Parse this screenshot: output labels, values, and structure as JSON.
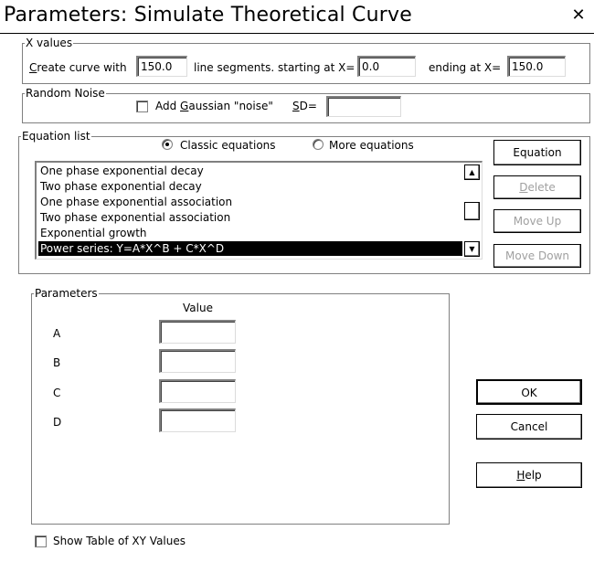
{
  "window": {
    "title": "Parameters: Simulate Theoretical Curve",
    "close_glyph": "✕"
  },
  "xvalues": {
    "legend": "X values",
    "create_label_pre": "C",
    "create_label_rest": "reate curve with",
    "segments_value": "150.0",
    "segments_label": "line segments. starting at X=",
    "start_value": "0.0",
    "end_label": "ending at X=",
    "end_value": "150.0"
  },
  "noise": {
    "legend": "Random Noise",
    "add_label_pre": "Add ",
    "add_label_ul": "G",
    "add_label_post": "aussian \"noise\"",
    "add_checked": false,
    "sd_ul": "S",
    "sd_label_rest": "D=",
    "sd_value": ""
  },
  "equations": {
    "legend": "Equation list",
    "classic_label": "Classic equations",
    "more_label": "More equations",
    "selected_mode": "classic",
    "items": [
      "One phase exponential decay",
      "Two phase exponential decay",
      "One phase exponential association",
      "Two phase exponential association",
      "Exponential growth",
      "Power series: Y=A*X^B + C*X^D"
    ],
    "selected_index": 5
  },
  "buttons": {
    "equation": "Equation",
    "delete_ul": "D",
    "delete_rest": "elete",
    "move_up": "Move Up",
    "move_down": "Move Down",
    "ok": "OK",
    "cancel": "Cancel",
    "help_ul": "H",
    "help_rest": "elp"
  },
  "parameters": {
    "legend": "Parameters",
    "value_header": "Value",
    "rows": [
      {
        "name": "A",
        "value": ""
      },
      {
        "name": "B",
        "value": ""
      },
      {
        "name": "C",
        "value": ""
      },
      {
        "name": "D",
        "value": ""
      }
    ]
  },
  "show_table": {
    "label": "Show Table of XY Values",
    "checked": false
  }
}
